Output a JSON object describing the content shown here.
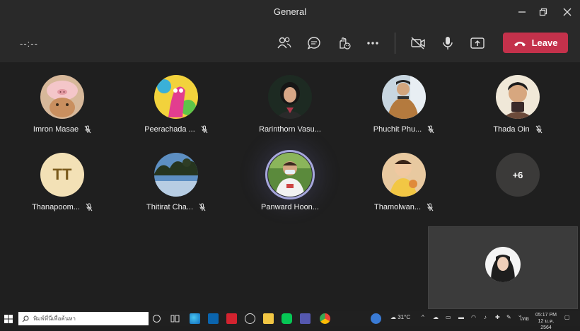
{
  "window": {
    "title": "General"
  },
  "controls": {
    "timer": "--:--",
    "leave_label": "Leave",
    "colors": {
      "leave": "#c4314b"
    }
  },
  "participants": [
    {
      "name": "Imron Masae",
      "muted": true
    },
    {
      "name": "Peerachada ...",
      "muted": true
    },
    {
      "name": "Rarinthorn Vasu...",
      "muted": false
    },
    {
      "name": "Phuchit Phu...",
      "muted": true
    },
    {
      "name": "Thada Oin",
      "muted": true
    },
    {
      "name": "Thanapoom...",
      "initials": "TT",
      "muted": true
    },
    {
      "name": "Thitirat Cha...",
      "muted": true
    },
    {
      "name": "Panward Hoon...",
      "muted": false,
      "active_speaker": true
    },
    {
      "name": "Thamolwan...",
      "muted": true
    }
  ],
  "overflow": {
    "label": "+6"
  },
  "taskbar": {
    "search_placeholder": "พิมพ์ที่นี่เพื่อค้นหา",
    "weather": "31°C",
    "language": "ไทย",
    "time": "05:17 PM",
    "date": "12 ม.ค. 2564"
  }
}
